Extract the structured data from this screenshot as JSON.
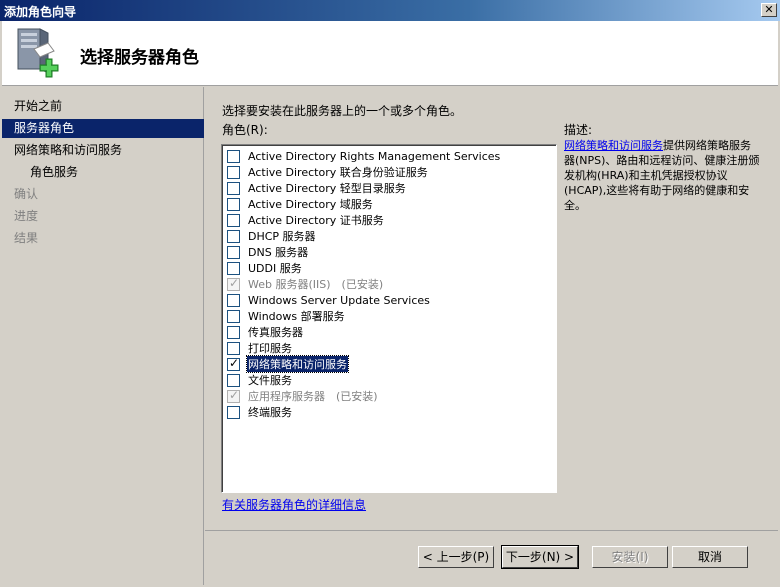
{
  "window": {
    "title": "添加角色向导",
    "close_glyph": "✕"
  },
  "header": {
    "title": "选择服务器角色",
    "icon": "server-add-icon"
  },
  "nav": {
    "items": [
      {
        "label": "开始之前",
        "state": "normal"
      },
      {
        "label": "服务器角色",
        "state": "selected"
      },
      {
        "label": "网络策略和访问服务",
        "state": "normal"
      },
      {
        "label": "角色服务",
        "state": "sub"
      },
      {
        "label": "确认",
        "state": "disabled"
      },
      {
        "label": "进度",
        "state": "disabled"
      },
      {
        "label": "结果",
        "state": "disabled"
      }
    ]
  },
  "content": {
    "instruction": "选择要安装在此服务器上的一个或多个角色。",
    "roles_label": "角色(R):",
    "description_title": "描述:",
    "description_link": "网络策略和访问服务",
    "description_text": "提供网络策略服务器(NPS)、路由和远程访问、健康注册颁发机构(HRA)和主机凭据授权协议(HCAP),这些将有助于网络的健康和安全。",
    "more_info_link": "有关服务器角色的详细信息"
  },
  "roles": [
    {
      "label": "Active Directory Rights Management Services",
      "checked": false,
      "disabled": false,
      "installed": ""
    },
    {
      "label": "Active Directory 联合身份验证服务",
      "checked": false,
      "disabled": false,
      "installed": ""
    },
    {
      "label": "Active Directory 轻型目录服务",
      "checked": false,
      "disabled": false,
      "installed": ""
    },
    {
      "label": "Active Directory 域服务",
      "checked": false,
      "disabled": false,
      "installed": ""
    },
    {
      "label": "Active Directory 证书服务",
      "checked": false,
      "disabled": false,
      "installed": ""
    },
    {
      "label": "DHCP 服务器",
      "checked": false,
      "disabled": false,
      "installed": ""
    },
    {
      "label": "DNS 服务器",
      "checked": false,
      "disabled": false,
      "installed": ""
    },
    {
      "label": "UDDI 服务",
      "checked": false,
      "disabled": false,
      "installed": ""
    },
    {
      "label": "Web 服务器(IIS)",
      "checked": true,
      "disabled": true,
      "installed": "(已安装)"
    },
    {
      "label": "Windows Server Update Services",
      "checked": false,
      "disabled": false,
      "installed": ""
    },
    {
      "label": "Windows 部署服务",
      "checked": false,
      "disabled": false,
      "installed": ""
    },
    {
      "label": "传真服务器",
      "checked": false,
      "disabled": false,
      "installed": ""
    },
    {
      "label": "打印服务",
      "checked": false,
      "disabled": false,
      "installed": ""
    },
    {
      "label": "网络策略和访问服务",
      "checked": true,
      "disabled": false,
      "installed": "",
      "selected": true
    },
    {
      "label": "文件服务",
      "checked": false,
      "disabled": false,
      "installed": ""
    },
    {
      "label": "应用程序服务器",
      "checked": true,
      "disabled": true,
      "installed": "(已安装)"
    },
    {
      "label": "终端服务",
      "checked": false,
      "disabled": false,
      "installed": ""
    }
  ],
  "buttons": {
    "prev": "< 上一步(P)",
    "next": "下一步(N) >",
    "install": "安装(I)",
    "cancel": "取消"
  },
  "colors": {
    "selection": "#0a246a",
    "link": "#0000ee",
    "dialog": "#d4d0c8"
  }
}
